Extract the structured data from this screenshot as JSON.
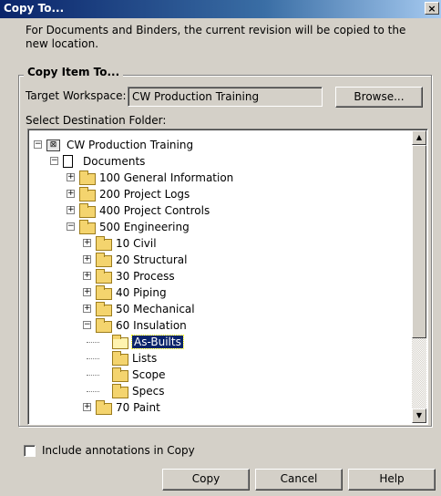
{
  "window": {
    "title": "Copy To...",
    "close_glyph": "×"
  },
  "description": "For Documents and Binders, the current revision will be copied to the new location.",
  "group": {
    "label": "Copy Item To..."
  },
  "target_workspace": {
    "label": "Target Workspace:",
    "value": "CW Production Training",
    "browse_label": "Browse..."
  },
  "destination": {
    "label": "Select Destination Folder:"
  },
  "tree": [
    {
      "label": "CW Production Training",
      "level": 0,
      "icon": "workspace-icon",
      "expander": "minus"
    },
    {
      "label": "Documents",
      "level": 1,
      "icon": "document-icon",
      "expander": "minus"
    },
    {
      "label": "100 General Information",
      "level": 2,
      "icon": "folder-icon",
      "expander": "plus"
    },
    {
      "label": "200 Project Logs",
      "level": 2,
      "icon": "folder-icon",
      "expander": "plus"
    },
    {
      "label": "400 Project Controls",
      "level": 2,
      "icon": "folder-icon",
      "expander": "plus"
    },
    {
      "label": "500 Engineering",
      "level": 2,
      "icon": "folder-icon",
      "expander": "minus"
    },
    {
      "label": "10 Civil",
      "level": 3,
      "icon": "folder-icon",
      "expander": "plus"
    },
    {
      "label": "20 Structural",
      "level": 3,
      "icon": "folder-icon",
      "expander": "plus"
    },
    {
      "label": "30 Process",
      "level": 3,
      "icon": "folder-icon",
      "expander": "plus"
    },
    {
      "label": "40 Piping",
      "level": 3,
      "icon": "folder-icon",
      "expander": "plus"
    },
    {
      "label": "50 Mechanical",
      "level": 3,
      "icon": "folder-icon",
      "expander": "plus"
    },
    {
      "label": "60 Insulation",
      "level": 3,
      "icon": "folder-icon",
      "expander": "minus"
    },
    {
      "label": "As-Builts",
      "level": 4,
      "icon": "open-folder-icon",
      "expander": "none",
      "selected": true
    },
    {
      "label": "Lists",
      "level": 4,
      "icon": "folder-icon",
      "expander": "none"
    },
    {
      "label": "Scope",
      "level": 4,
      "icon": "folder-icon",
      "expander": "none"
    },
    {
      "label": "Specs",
      "level": 4,
      "icon": "folder-icon",
      "expander": "none"
    },
    {
      "label": "70 Paint",
      "level": 3,
      "icon": "folder-icon",
      "expander": "plus"
    }
  ],
  "include_annotations": {
    "label": "Include annotations in Copy",
    "checked": false
  },
  "buttons": {
    "copy": "Copy",
    "cancel": "Cancel",
    "help": "Help"
  },
  "scrollbar": {
    "up_glyph": "▲",
    "down_glyph": "▼"
  }
}
